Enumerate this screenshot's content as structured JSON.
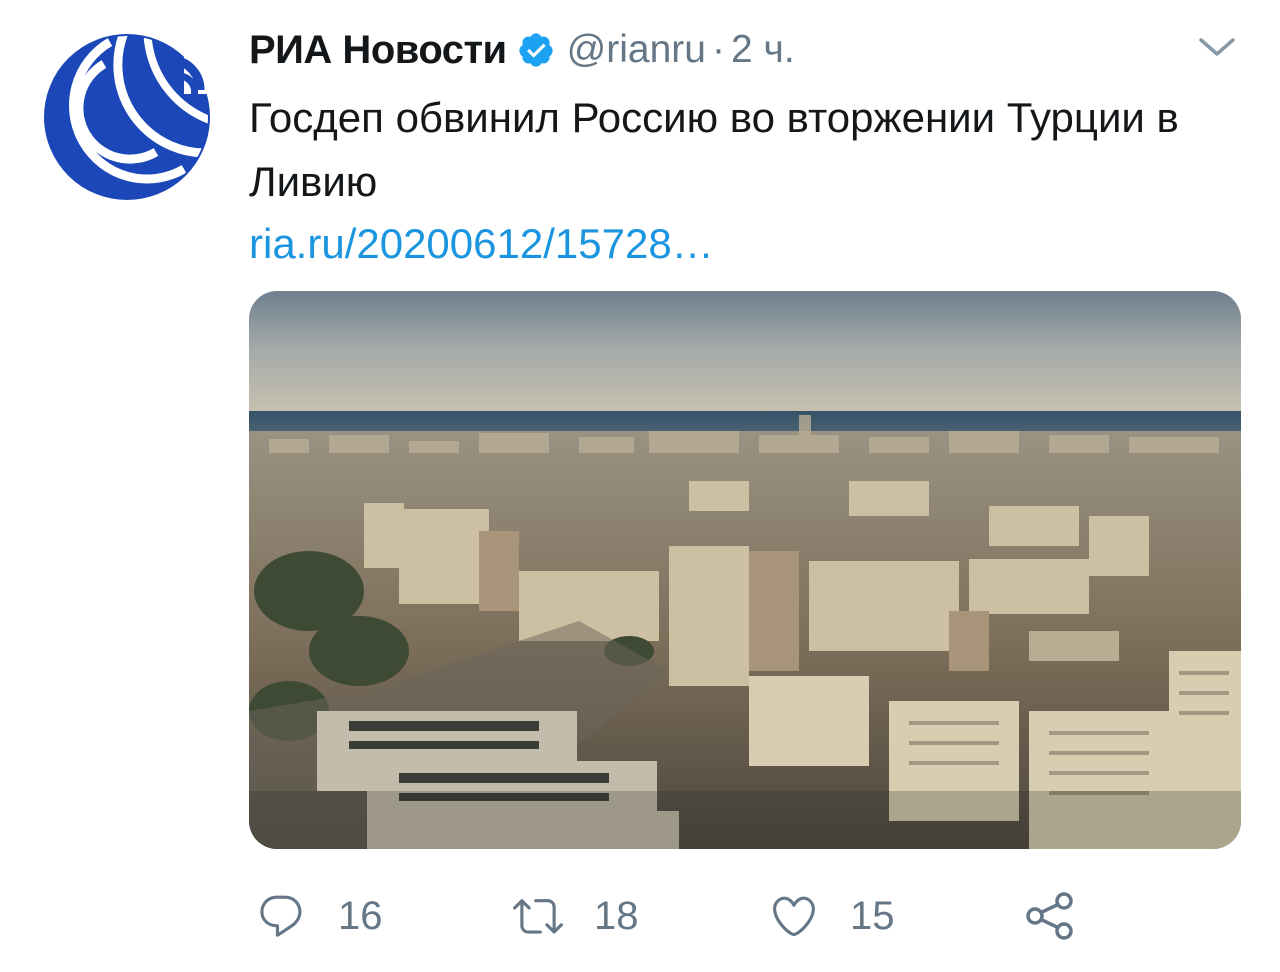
{
  "tweet": {
    "author_name": "РИА Новости",
    "handle": "@rianru",
    "separator": "·",
    "time": "2 ч.",
    "text": "Госдеп обвинил Россию во вторжении Турции в Ливию",
    "link": "ria.ru/20200612/15728…"
  },
  "actions": {
    "replies": "16",
    "retweets": "18",
    "likes": "15"
  },
  "colors": {
    "brand_blue": "#1b47b8",
    "link": "#1b95e0",
    "verified": "#1da1f2",
    "muted": "#657786"
  },
  "icons": {
    "verified": "verified-badge-icon",
    "caret": "chevron-down-icon",
    "reply": "speech-bubble-icon",
    "retweet": "retweet-arrows-icon",
    "like": "heart-icon",
    "share": "share-nodes-icon"
  }
}
